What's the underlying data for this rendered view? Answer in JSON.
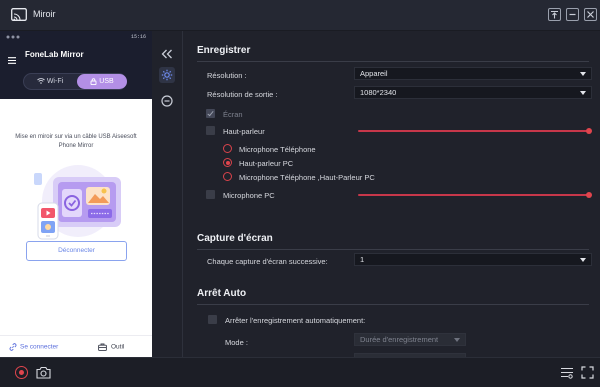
{
  "window": {
    "title": "Miroir",
    "icons": [
      "app-logo-icon",
      "pin-icon",
      "minimize-icon",
      "close-icon"
    ]
  },
  "phone": {
    "status_time": "15:16",
    "app_name": "FoneLab Mirror",
    "tabs": [
      {
        "label": "Wi-Fi",
        "icon": "wifi-icon",
        "active": false
      },
      {
        "label": "USB",
        "icon": "usb-lock-icon",
        "active": true
      }
    ],
    "description": "Mise en miroir sur via un câble USB Aiseesoft Phone Mirror",
    "disconnect_label": "Déconnecter",
    "footer": {
      "connect_label": "Se connecter",
      "tools_label": "Outil"
    }
  },
  "sidebar": {
    "items": [
      "collapse-icon",
      "settings-icon",
      "minus-circle-icon"
    ]
  },
  "record": {
    "section_title": "Enregistrer",
    "resolution_label": "Résolution :",
    "resolution_value": "Appareil",
    "output_resolution_label": "Résolution de sortie :",
    "output_resolution_value": "1080*2340",
    "screen_label": "Écran",
    "screen_checked": true,
    "speaker_label": "Haut-parleur",
    "speaker_checked": false,
    "speaker_volume": 1.0,
    "audio_sources": [
      {
        "label": "Microphone Téléphone",
        "selected": false
      },
      {
        "label": "Haut-parleur PC",
        "selected": true
      },
      {
        "label": "Microphone Téléphone ,Haut-Parleur PC",
        "selected": false
      }
    ],
    "pc_mic_label": "Microphone PC",
    "pc_mic_checked": false,
    "pc_mic_volume": 1.0
  },
  "capture": {
    "section_title": "Capture d'écran",
    "successive_label": "Chaque capture d'écran successive:",
    "successive_value": "1"
  },
  "auto_stop": {
    "section_title": "Arrêt Auto",
    "checkbox_label": "Arrêter l'enregistrement automatiquement:",
    "checked": false,
    "mode_label": "Mode :",
    "mode_value": "Durée d'enregistrement"
  },
  "bottom_toolbar": {
    "icons": [
      "record-icon",
      "camera-icon",
      "list-settings-icon",
      "fullscreen-icon"
    ]
  },
  "colors": {
    "accent_red": "#e0454d",
    "usb_tab": "#b38fe6",
    "link_blue": "#5b6fdc",
    "panel_bg": "#20222b"
  }
}
